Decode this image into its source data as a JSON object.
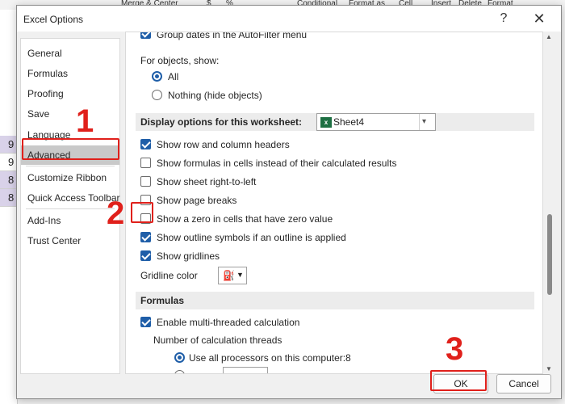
{
  "window": {
    "title": "Excel Options",
    "help": "?",
    "close": "✕"
  },
  "background": {
    "ribbon": [
      "Merge & Center",
      "$",
      "%",
      "Conditional",
      "Format as",
      "Cell",
      "Insert",
      "Delete",
      "Format"
    ],
    "cells": [
      "9",
      "9",
      "8",
      "8"
    ]
  },
  "nav": {
    "items": [
      {
        "label": "General"
      },
      {
        "label": "Formulas"
      },
      {
        "label": "Proofing"
      },
      {
        "label": "Save"
      },
      {
        "label": "Language"
      },
      {
        "label": "Advanced",
        "selected": true
      },
      {
        "label": "Customize Ribbon"
      },
      {
        "label": "Quick Access Toolbar"
      },
      {
        "label": "Add-Ins"
      },
      {
        "label": "Trust Center"
      }
    ]
  },
  "content": {
    "top_option": {
      "label": "Group dates in the AutoFilter menu",
      "checked": true
    },
    "objects_label": "For objects, show:",
    "objects_all": {
      "label": "All",
      "selected": true
    },
    "objects_nothing": {
      "label": "Nothing (hide objects)",
      "selected": false
    },
    "sheet_section": "Display options for this worksheet:",
    "sheet_select": {
      "value": "Sheet4",
      "icon": "excel-sheet-icon",
      "icon_text": "x"
    },
    "sheet_options": [
      {
        "label": "Show row and column headers",
        "checked": true
      },
      {
        "label": "Show formulas in cells instead of their calculated results",
        "checked": false
      },
      {
        "label": "Show sheet right-to-left",
        "checked": false
      },
      {
        "label": "Show page breaks",
        "checked": false
      },
      {
        "label": "Show a zero in cells that have zero value",
        "checked": false
      },
      {
        "label": "Show outline symbols if an outline is applied",
        "checked": true
      },
      {
        "label": "Show gridlines",
        "checked": true
      }
    ],
    "gridline_color_label": "Gridline color",
    "gridline_color_icon": "paint-bucket-icon",
    "gridline_bucket": "⛽",
    "gridline_arrow": "▼",
    "formulas_section": "Formulas",
    "multithread": {
      "label": "Enable multi-threaded calculation",
      "checked": true
    },
    "threads_label": "Number of calculation threads",
    "use_all": {
      "label": "Use all processors on this computer:",
      "value": "8",
      "selected": true
    }
  },
  "buttons": {
    "ok": "OK",
    "cancel": "Cancel"
  },
  "annotations": {
    "step1": "1",
    "step2": "2",
    "step3": "3"
  },
  "colors": {
    "accent": "#1f5ea8",
    "annotation": "#e0201b"
  }
}
